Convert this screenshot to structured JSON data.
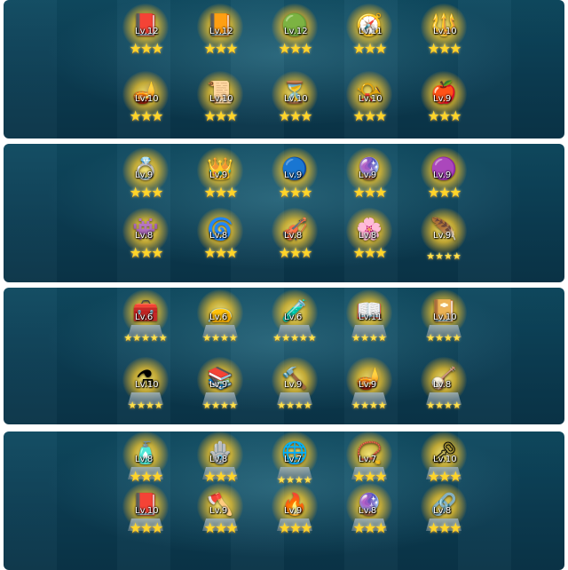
{
  "panels": [
    {
      "rows": [
        [
          {
            "icon": "grimoire-icon",
            "glyph": "📕",
            "level": "Lv.12",
            "stars": 3
          },
          {
            "icon": "book-icon",
            "glyph": "📙",
            "level": "Lv.12",
            "stars": 3
          },
          {
            "icon": "amulet-icon",
            "glyph": "🟢",
            "level": "Lv.12",
            "stars": 3
          },
          {
            "icon": "compass-icon",
            "glyph": "🧭",
            "level": "Lv.11",
            "stars": 3
          },
          {
            "icon": "scepter-icon",
            "glyph": "🔱",
            "level": "Lv.10",
            "stars": 3
          }
        ],
        [
          {
            "icon": "magic-lamp-icon",
            "glyph": "🪔",
            "level": "Lv.10",
            "stars": 3
          },
          {
            "icon": "scroll-staff-icon",
            "glyph": "📜",
            "level": "Lv.10",
            "stars": 3
          },
          {
            "icon": "hourglass-icon",
            "glyph": "⏳",
            "level": "Lv.10",
            "stars": 3
          },
          {
            "icon": "horn-icon",
            "glyph": "📯",
            "level": "Lv.10",
            "stars": 3
          },
          {
            "icon": "golden-apple-icon",
            "glyph": "🍎",
            "level": "Lv.9",
            "stars": 3
          }
        ]
      ]
    },
    {
      "rows": [
        [
          {
            "icon": "ring-icon",
            "glyph": "💍",
            "level": "Lv.9",
            "stars": 3
          },
          {
            "icon": "crown-icon",
            "glyph": "👑",
            "level": "Lv.9",
            "stars": 3
          },
          {
            "icon": "mirror-icon",
            "glyph": "🔵",
            "level": "Lv.9",
            "stars": 3
          },
          {
            "icon": "purple-potion-icon",
            "glyph": "🔮",
            "level": "Lv.9",
            "stars": 3
          },
          {
            "icon": "orb-icon",
            "glyph": "🟣",
            "level": "Lv.9",
            "stars": 3
          }
        ],
        [
          {
            "icon": "imp-figure-icon",
            "glyph": "👾",
            "level": "Lv.8",
            "stars": 3
          },
          {
            "icon": "green-portal-icon",
            "glyph": "🌀",
            "level": "Lv.8",
            "stars": 3
          },
          {
            "icon": "lute-icon",
            "glyph": "🎻",
            "level": "Lv.8",
            "stars": 3
          },
          {
            "icon": "flower-icon",
            "glyph": "🌸",
            "level": "Lv.8",
            "stars": 3
          },
          {
            "icon": "feather-icon",
            "glyph": "🪶",
            "level": "Lv.9",
            "stars": 4
          }
        ]
      ]
    },
    {
      "rows": [
        [
          {
            "icon": "treasure-chest-icon",
            "glyph": "🧰",
            "level": "Lv.6",
            "stars": 5
          },
          {
            "icon": "pouch-icon",
            "glyph": "👝",
            "level": "Lv.6",
            "stars": 4
          },
          {
            "icon": "blue-potion-icon",
            "glyph": "🧪",
            "level": "Lv.6",
            "stars": 5
          },
          {
            "icon": "spellbook-icon",
            "glyph": "📖",
            "level": "Lv.11",
            "stars": 4
          },
          {
            "icon": "tome-icon",
            "glyph": "📔",
            "level": "Lv.10",
            "stars": 4
          }
        ],
        [
          {
            "icon": "pink-flask-icon",
            "glyph": "⚗",
            "level": "Lv.10",
            "stars": 4
          },
          {
            "icon": "open-book-icon",
            "glyph": "📚",
            "level": "Lv.9",
            "stars": 4
          },
          {
            "icon": "hammer-icon",
            "glyph": "🔨",
            "level": "Lv.9",
            "stars": 4
          },
          {
            "icon": "genie-lamp-icon",
            "glyph": "🪔",
            "level": "Lv.9",
            "stars": 4
          },
          {
            "icon": "harp-icon",
            "glyph": "🪕",
            "level": "Lv.8",
            "stars": 4
          }
        ]
      ]
    },
    {
      "rows": [
        [
          {
            "icon": "vial-icon",
            "glyph": "🧴",
            "level": "Lv.8",
            "stars": 3
          },
          {
            "icon": "charm-icon",
            "glyph": "🪬",
            "level": "Lv.8",
            "stars": 3
          },
          {
            "icon": "globe-icon",
            "glyph": "🌐",
            "level": "Lv.7",
            "stars": 4
          },
          {
            "icon": "pendant-icon",
            "glyph": "📿",
            "level": "Lv.7",
            "stars": 3
          },
          {
            "icon": "key-icon",
            "glyph": "🗝",
            "level": "Lv.10",
            "stars": 3
          }
        ],
        [
          {
            "icon": "red-book-icon",
            "glyph": "📕",
            "level": "Lv.10",
            "stars": 3
          },
          {
            "icon": "axe-icon",
            "glyph": "🪓",
            "level": "Lv.9",
            "stars": 3
          },
          {
            "icon": "flame-bowl-icon",
            "glyph": "🔥",
            "level": "Lv.9",
            "stars": 3
          },
          {
            "icon": "crystal-globe-icon",
            "glyph": "🔮",
            "level": "Lv.8",
            "stars": 3
          },
          {
            "icon": "pendulum-icon",
            "glyph": "🔗",
            "level": "Lv.8",
            "stars": 3
          }
        ]
      ]
    }
  ]
}
